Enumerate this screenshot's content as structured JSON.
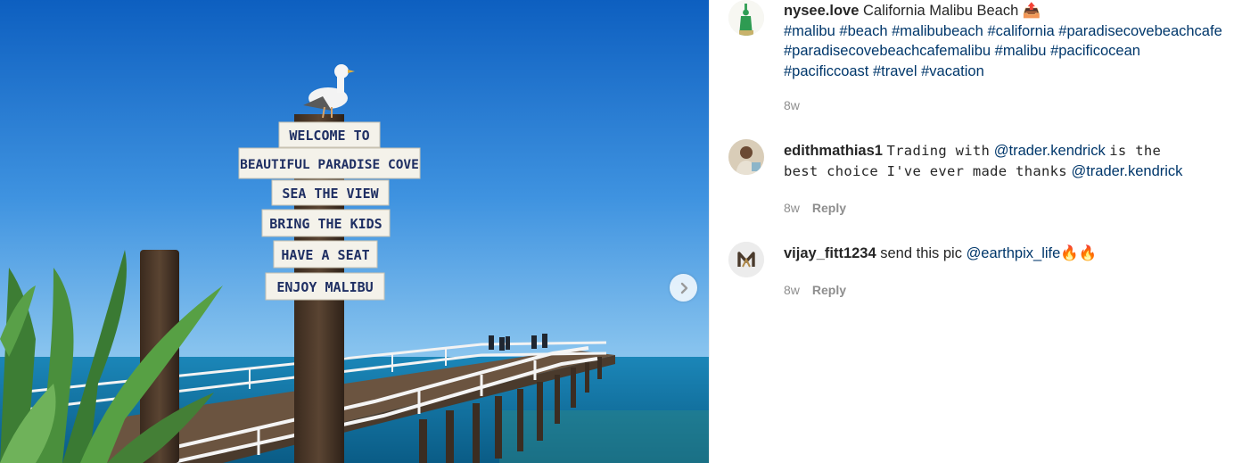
{
  "photo": {
    "signs": [
      "WELCOME TO",
      "BEAUTIFUL PARADISE COVE",
      "SEA THE VIEW",
      "BRING THE KIDS",
      "HAVE A SEAT",
      "ENJOY MALIBU"
    ],
    "colors": {
      "sky_top": "#0f62c2",
      "sky_bottom": "#6fb6ec",
      "sea": "#0f6f9f",
      "sign_text": "#1f2f63"
    }
  },
  "post": {
    "username": "nysee.love",
    "caption": "California Malibu Beach 📤",
    "hashtags_line1": [
      "#malibu",
      "#beach",
      "#malibubeach",
      "#california",
      "#paradisecovebeachcafe"
    ],
    "hashtags_line2": [
      "#paradisecovebeachcafemalibu",
      "#malibu",
      "#pacificocean"
    ],
    "hashtags_line3": [
      "#pacificcoast",
      "#travel",
      "#vacation"
    ],
    "time": "8w",
    "avatar_icon": "statue-of-liberty-avatar"
  },
  "comments": [
    {
      "username": "edithmathias1",
      "text_part1": "Trading with",
      "mention1": "@trader.kendrick",
      "text_part2": "is the",
      "text_part3": "best choice I've ever made thanks",
      "mention2": "@trader.kendrick",
      "time": "8w",
      "reply_label": "Reply"
    },
    {
      "username": "vijay_fitt1234",
      "text_part1": "send this pic",
      "mention1": "@earthpix_life",
      "emoji": "🔥🔥",
      "time": "8w",
      "reply_label": "Reply"
    }
  ],
  "colors": {
    "link": "#00376b",
    "muted": "#8e8e8e",
    "text": "#262626"
  },
  "icons": {
    "next": "chevron-right-icon"
  }
}
